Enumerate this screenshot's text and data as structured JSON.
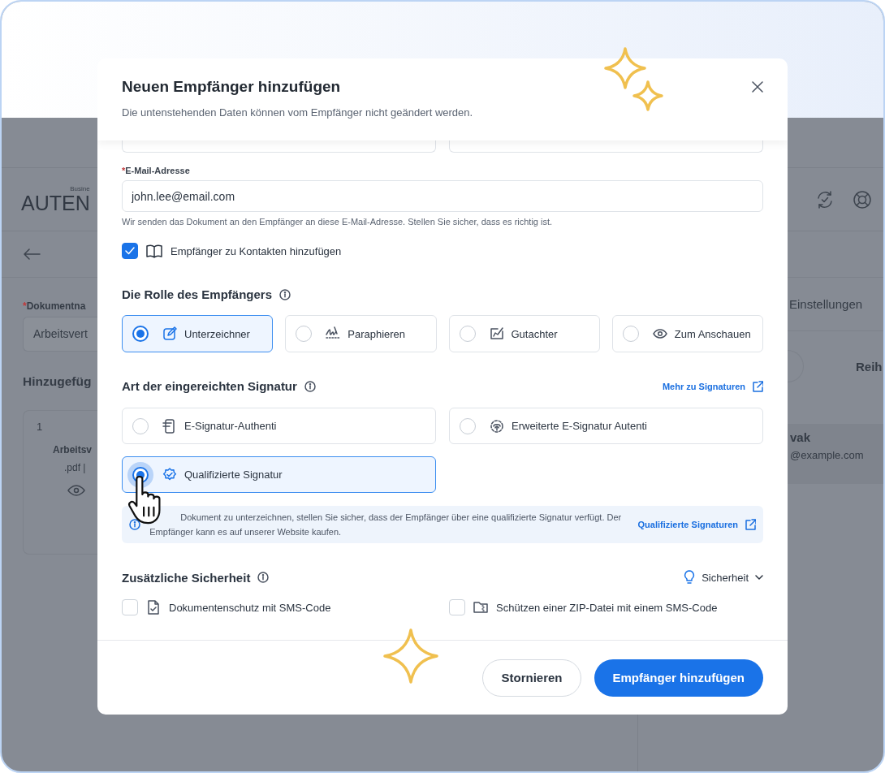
{
  "background": {
    "logo_caption": "Busine",
    "logo": "AUTEN",
    "document_name": {
      "required_mark": "*",
      "label": "Dokumentna",
      "value": "Arbeitsvert"
    },
    "added_heading": "Hinzugefüg",
    "document_card": {
      "index": "1",
      "name": "Arbeitsv",
      "meta": ".pdf |"
    },
    "settings_tab": "Einstellungen",
    "order_heading": "Reih",
    "recipient": {
      "name": "vak",
      "email": "@example.com"
    }
  },
  "modal": {
    "title": "Neuen Empfänger hinzufügen",
    "subtitle": "Die untenstehenden Daten können vom Empfänger nicht geändert werden.",
    "email": {
      "required_mark": "*",
      "label": "E-Mail-Adresse",
      "value": "john.lee@email.com",
      "hint": "Wir senden das Dokument an den Empfänger an diese E-Mail-Adresse. Stellen Sie sicher, dass es richtig ist."
    },
    "add_to_contacts": {
      "label": "Empfänger zu Kontakten hinzufügen",
      "checked": true
    },
    "role": {
      "heading": "Die Rolle des Empfängers",
      "options": [
        {
          "label": "Unterzeichner",
          "selected": true
        },
        {
          "label": "Paraphieren",
          "selected": false
        },
        {
          "label": "Gutachter",
          "selected": false
        },
        {
          "label": "Zum Anschauen",
          "selected": false
        }
      ]
    },
    "signature": {
      "heading": "Art der eingereichten Signatur",
      "link": "Mehr zu Signaturen",
      "options": [
        {
          "label": "E-Signatur-Authenti",
          "selected": false
        },
        {
          "label": "Erweiterte E-Signatur Autenti",
          "selected": false
        },
        {
          "label": "Qualifizierte Signatur",
          "selected": true
        }
      ],
      "info": {
        "text": "Dokument zu unterzeichnen, stellen Sie sicher, dass der Empfänger über eine qualifizierte Signatur verfügt. Der Empfänger kann es auf unserer Website kaufen.",
        "link": "Qualifizierte Signaturen"
      }
    },
    "security": {
      "heading": "Zusätzliche Sicherheit",
      "dropdown": "Sicherheit",
      "options": [
        {
          "label": "Dokumentenschutz mit SMS-Code",
          "checked": false
        },
        {
          "label": "Schützen einer ZIP-Datei mit einem SMS-Code",
          "checked": false
        }
      ]
    },
    "buttons": [
      {
        "label": "Stornieren",
        "kind": "secondary"
      },
      {
        "label": "Empfänger hinzufügen",
        "kind": "primary"
      }
    ]
  }
}
